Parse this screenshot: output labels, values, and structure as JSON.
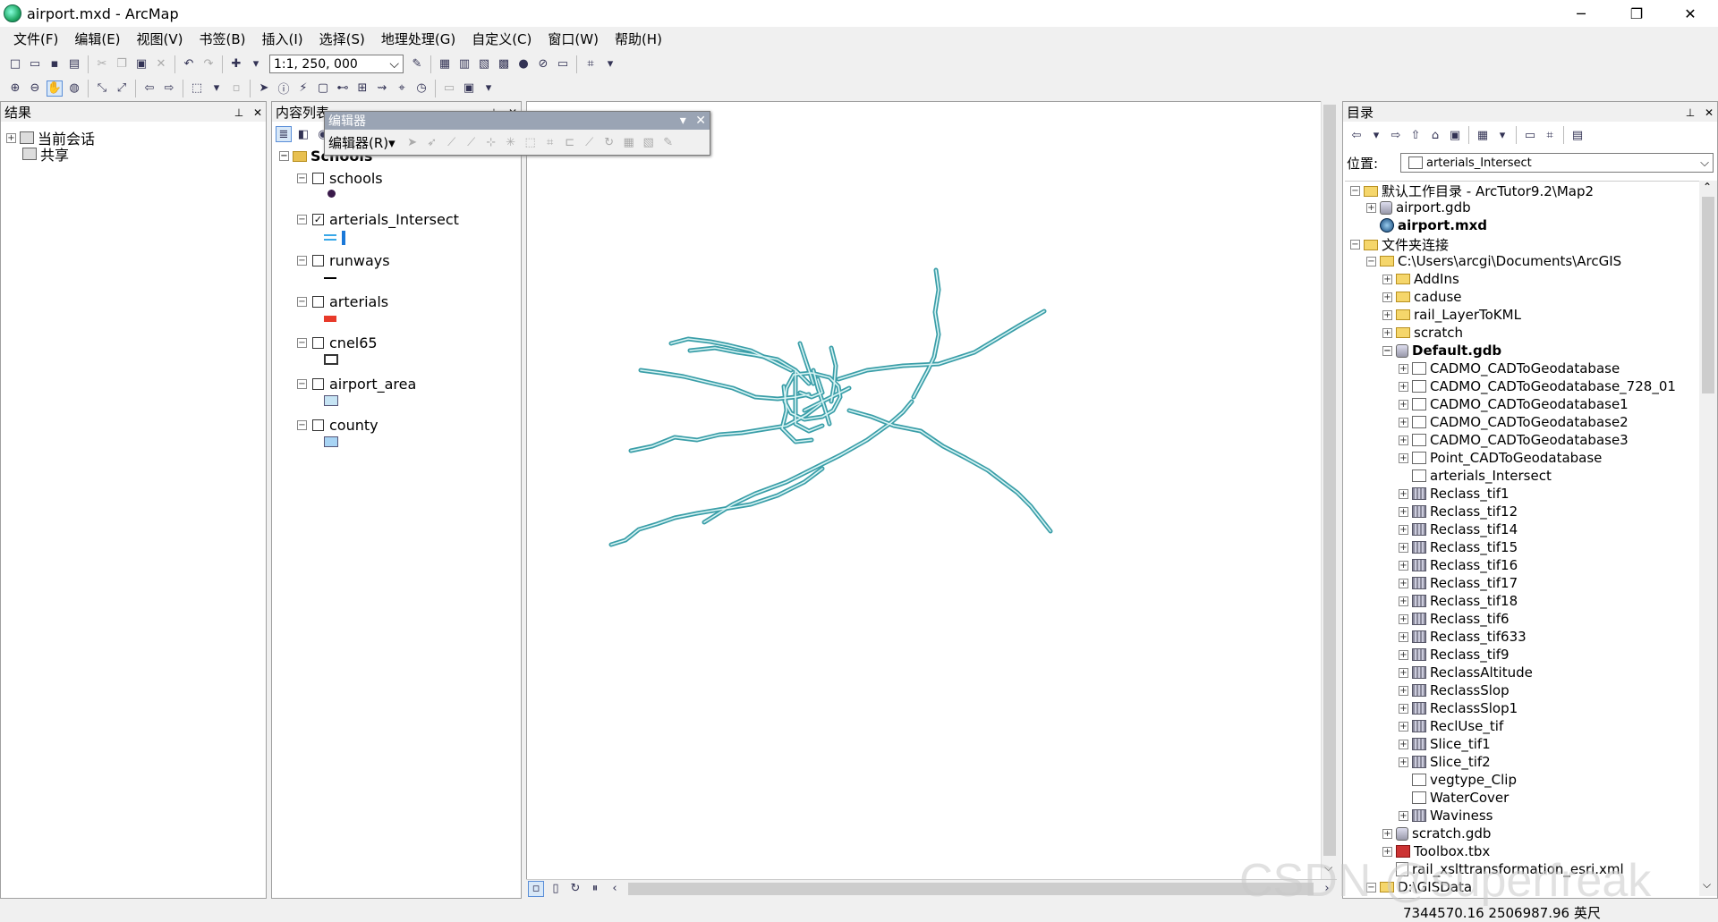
{
  "window": {
    "title": "airport.mxd - ArcMap",
    "minimize": "─",
    "maximize": "❐",
    "close": "✕"
  },
  "menu": [
    "文件(F)",
    "编辑(E)",
    "视图(V)",
    "书签(B)",
    "插入(I)",
    "选择(S)",
    "地理处理(G)",
    "自定义(C)",
    "窗口(W)",
    "帮助(H)"
  ],
  "toolbar": {
    "scale": "1:1, 250, 000"
  },
  "results": {
    "title": "结果",
    "items": [
      "当前会话",
      "共享"
    ]
  },
  "toc": {
    "title": "内容列表",
    "group": "Schools",
    "layers": [
      {
        "name": "schools",
        "checked": false,
        "symbol": "point",
        "color": "#3a1a4a"
      },
      {
        "name": "arterials_Intersect",
        "checked": true,
        "symbol": "line-double",
        "color": "#3aa8e8"
      },
      {
        "name": "runways",
        "checked": false,
        "symbol": "line",
        "color": "#000000"
      },
      {
        "name": "arterials",
        "checked": false,
        "symbol": "bar",
        "color": "#e83a2a"
      },
      {
        "name": "cnel65",
        "checked": false,
        "symbol": "hollow",
        "color": "#ffffff"
      },
      {
        "name": "airport_area",
        "checked": false,
        "symbol": "fill",
        "color": "#c6e4f4"
      },
      {
        "name": "county",
        "checked": false,
        "symbol": "fill",
        "color": "#a8d4f4"
      }
    ]
  },
  "editor": {
    "title": "编辑器",
    "menu": "编辑器(R)▾"
  },
  "catalog": {
    "title": "目录",
    "location_label": "位置:",
    "location_value": "arterials_Intersect",
    "tree": [
      {
        "label": "默认工作目录 - ArcTutor9.2\\Map2",
        "level": 0,
        "icon": "folder",
        "exp": "⊟"
      },
      {
        "label": "airport.gdb",
        "level": 1,
        "icon": "gdb",
        "exp": "⊞"
      },
      {
        "label": "airport.mxd",
        "level": 1,
        "icon": "mxd",
        "exp": "",
        "bold": true
      },
      {
        "label": "文件夹连接",
        "level": 0,
        "icon": "folder",
        "exp": "⊟"
      },
      {
        "label": "C:\\Users\\arcgi\\Documents\\ArcGIS",
        "level": 1,
        "icon": "folder",
        "exp": "⊟"
      },
      {
        "label": "AddIns",
        "level": 2,
        "icon": "folder",
        "exp": "⊞"
      },
      {
        "label": "caduse",
        "level": 2,
        "icon": "folder",
        "exp": "⊞"
      },
      {
        "label": "rail_LayerToKML",
        "level": 2,
        "icon": "folder",
        "exp": "⊞"
      },
      {
        "label": "scratch",
        "level": 2,
        "icon": "folder",
        "exp": "⊞"
      },
      {
        "label": "Default.gdb",
        "level": 2,
        "icon": "gdb",
        "exp": "⊟",
        "bold": true
      },
      {
        "label": "CADMO_CADToGeodatabase",
        "level": 3,
        "icon": "fc",
        "exp": "⊞"
      },
      {
        "label": "CADMO_CADToGeodatabase_728_01",
        "level": 3,
        "icon": "fc",
        "exp": "⊞"
      },
      {
        "label": "CADMO_CADToGeodatabase1",
        "level": 3,
        "icon": "fc",
        "exp": "⊞"
      },
      {
        "label": "CADMO_CADToGeodatabase2",
        "level": 3,
        "icon": "fc",
        "exp": "⊞"
      },
      {
        "label": "CADMO_CADToGeodatabase3",
        "level": 3,
        "icon": "fc",
        "exp": "⊞"
      },
      {
        "label": "Point_CADToGeodatabase",
        "level": 3,
        "icon": "fc",
        "exp": "⊞"
      },
      {
        "label": "arterials_Intersect",
        "level": 3,
        "icon": "fc",
        "exp": ""
      },
      {
        "label": "Reclass_tif1",
        "level": 3,
        "icon": "raster",
        "exp": "⊞"
      },
      {
        "label": "Reclass_tif12",
        "level": 3,
        "icon": "raster",
        "exp": "⊞"
      },
      {
        "label": "Reclass_tif14",
        "level": 3,
        "icon": "raster",
        "exp": "⊞"
      },
      {
        "label": "Reclass_tif15",
        "level": 3,
        "icon": "raster",
        "exp": "⊞"
      },
      {
        "label": "Reclass_tif16",
        "level": 3,
        "icon": "raster",
        "exp": "⊞"
      },
      {
        "label": "Reclass_tif17",
        "level": 3,
        "icon": "raster",
        "exp": "⊞"
      },
      {
        "label": "Reclass_tif18",
        "level": 3,
        "icon": "raster",
        "exp": "⊞"
      },
      {
        "label": "Reclass_tif6",
        "level": 3,
        "icon": "raster",
        "exp": "⊞"
      },
      {
        "label": "Reclass_tif633",
        "level": 3,
        "icon": "raster",
        "exp": "⊞"
      },
      {
        "label": "Reclass_tif9",
        "level": 3,
        "icon": "raster",
        "exp": "⊞"
      },
      {
        "label": "ReclassAltitude",
        "level": 3,
        "icon": "raster",
        "exp": "⊞"
      },
      {
        "label": "ReclassSlop",
        "level": 3,
        "icon": "raster",
        "exp": "⊞"
      },
      {
        "label": "ReclassSlop1",
        "level": 3,
        "icon": "raster",
        "exp": "⊞"
      },
      {
        "label": "ReclUse_tif",
        "level": 3,
        "icon": "raster",
        "exp": "⊞"
      },
      {
        "label": "Slice_tif1",
        "level": 3,
        "icon": "raster",
        "exp": "⊞"
      },
      {
        "label": "Slice_tif2",
        "level": 3,
        "icon": "raster",
        "exp": "⊞"
      },
      {
        "label": "vegtype_Clip",
        "level": 3,
        "icon": "fc",
        "exp": ""
      },
      {
        "label": "WaterCover",
        "level": 3,
        "icon": "fc",
        "exp": ""
      },
      {
        "label": "Waviness",
        "level": 3,
        "icon": "raster",
        "exp": "⊞"
      },
      {
        "label": "scratch.gdb",
        "level": 2,
        "icon": "gdb",
        "exp": "⊞"
      },
      {
        "label": "Toolbox.tbx",
        "level": 2,
        "icon": "tbx",
        "exp": "⊞"
      },
      {
        "label": "rail_xslttransformation_esri.xml",
        "level": 2,
        "icon": "xml",
        "exp": ""
      },
      {
        "label": "D:\\GISData",
        "level": 1,
        "icon": "folder",
        "exp": "⊟"
      }
    ]
  },
  "status": {
    "coords": "7344570.16  2506987.96 英尺"
  },
  "watermark": "CSDN @superfreak",
  "map": {
    "road_color": "#3a9ea8",
    "road_fill": "#d8f4f4"
  }
}
